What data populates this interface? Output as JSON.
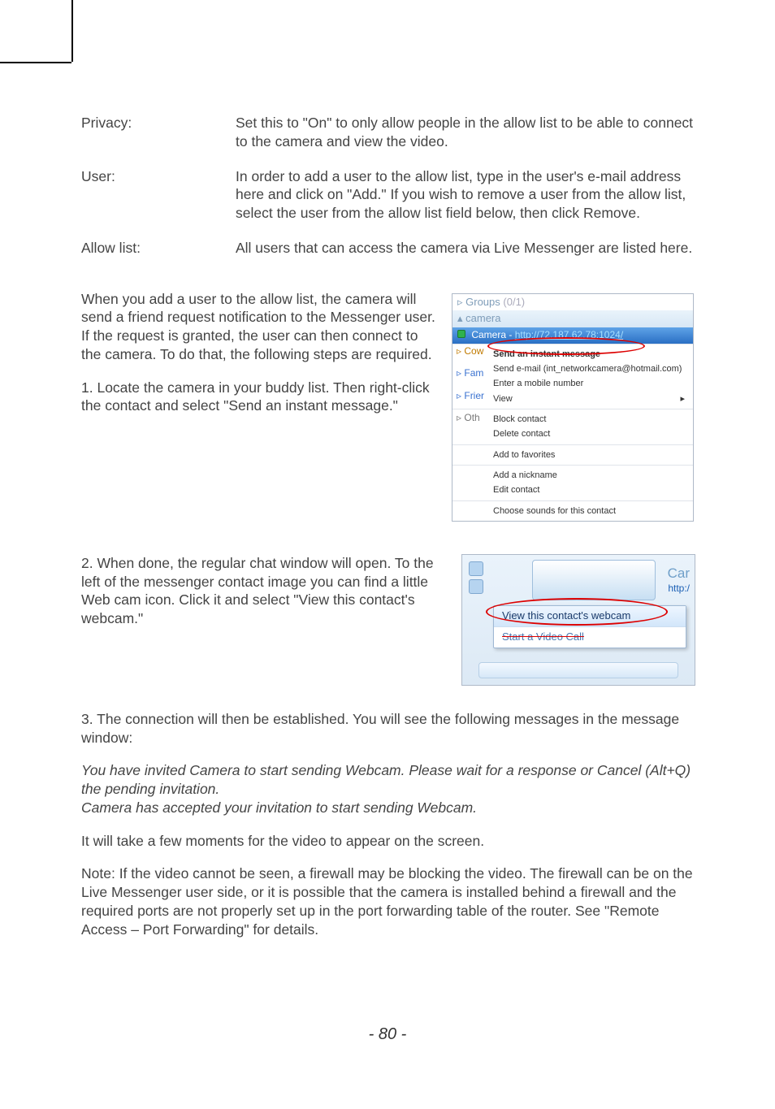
{
  "defs": {
    "privacy": {
      "term": "Privacy:",
      "desc": "Set this to \"On\" to only allow people in the allow list to be able to connect to the camera and view the video."
    },
    "user": {
      "term": "User:",
      "desc": "In order to add a user to the allow list, type in the user's e-mail address here and click on \"Add.\" If you wish to remove a user from the allow list, select the user from the allow list field below, then click Remove."
    },
    "allowlist": {
      "term": "Allow list:",
      "desc": "All users that can access the camera via Live Messenger are listed here."
    }
  },
  "para1": "When you add a user to the allow list, the camera will send a friend request notification to the Messenger user. If the request is granted, the user can then connect to the camera. To do that, the following steps are required.",
  "step1": "1. Locate the camera in your buddy list. Then right-click the contact and select \"Send an instant message.\"",
  "step2": "2. When done, the regular chat window will open. To the left of the messenger contact image you can find a little Web cam icon. Click it and select \"View this contact's webcam.\"",
  "step3": "3. The connection will then be established. You will see the following messages in the message window:",
  "italic1": "You have invited Camera to start sending Webcam. Please wait for a response or Cancel (Alt+Q) the pending invitation.",
  "italic2": "Camera has accepted your invitation to start sending Webcam.",
  "para_wait": "It will take a few moments for the video to appear on the screen.",
  "note": "Note: If the video cannot be seen, a firewall may be blocking the video. The firewall can be on the Live Messenger user side, or it is possible that the camera is installed behind a firewall and the required ports are not properly set up in the port forwarding table of the router. See \"Remote Access – Port Forwarding\" for details.",
  "page_number": "- 80 -",
  "ss1": {
    "groups_label": "▹ Groups",
    "groups_count": "(0/1)",
    "camera_head": "▴ camera",
    "camera_name": "Camera",
    "camera_url": "http://72.187.62.78:1024/",
    "side": {
      "co": "▹ Cow",
      "fam": "▹ Fam",
      "frie": "▹ Frier",
      "oth": "▹ Oth"
    },
    "menu": {
      "send_im": "Send an instant message",
      "send_email": "Send e-mail (int_networkcamera@hotmail.com)",
      "enter_mobile": "Enter a mobile number",
      "view": "View",
      "block": "Block contact",
      "delete": "Delete contact",
      "add_fav": "Add to favorites",
      "add_nick": "Add a nickname",
      "edit": "Edit contact",
      "sounds": "Choose sounds for this contact"
    }
  },
  "ss2": {
    "car": "Car",
    "http": "http:/",
    "view_webcam": "View this contact's webcam",
    "start_video": "Start a Video Call"
  }
}
